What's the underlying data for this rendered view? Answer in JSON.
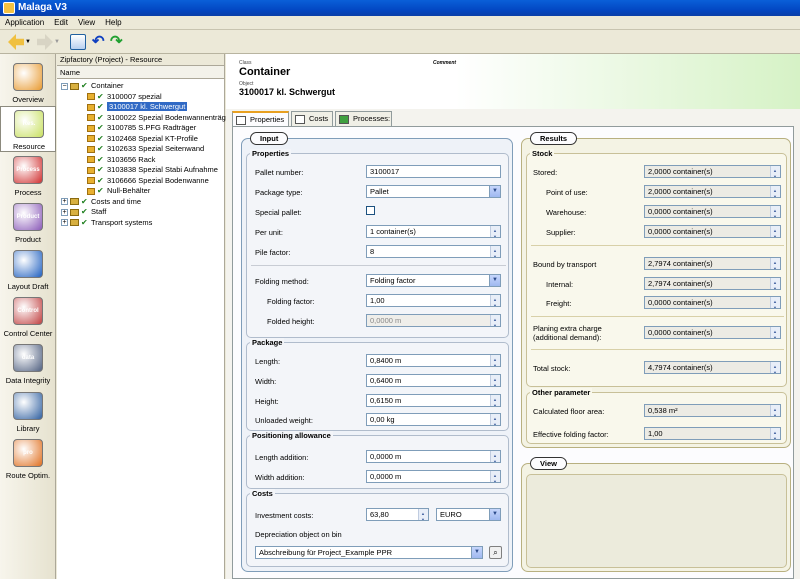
{
  "window": {
    "title": "Malaga V3"
  },
  "menu": [
    "Application",
    "Edit",
    "View",
    "Help"
  ],
  "nav": [
    {
      "label": "Overview",
      "icon": "overview-icon",
      "color": "#e89a30"
    },
    {
      "label": "Resource",
      "icon": "resource-icon",
      "color": "#c8e060",
      "selected": true,
      "text": "Res."
    },
    {
      "label": "Process",
      "icon": "process-icon",
      "color": "#d03030",
      "text": "Process"
    },
    {
      "label": "Product",
      "icon": "product-icon",
      "color": "#8a5ab8",
      "text": "Product"
    },
    {
      "label": "Layout Draft",
      "icon": "layout-draft-icon",
      "color": "#2060c0"
    },
    {
      "label": "Control Center",
      "icon": "control-center-icon",
      "color": "#c04040",
      "text": "Control Center"
    },
    {
      "label": "Data Integrity",
      "icon": "data-integrity-icon",
      "color": "#506080",
      "text": "data quality"
    },
    {
      "label": "Library",
      "icon": "library-icon",
      "color": "#3060a0"
    },
    {
      "label": "Route Optim.",
      "icon": "route-optim-icon",
      "color": "#e07020",
      "text": "pro"
    }
  ],
  "tree": {
    "title": "Zipfactory (Project) - Resource",
    "column": "Name",
    "nodes": [
      {
        "label": "Container",
        "level": 0,
        "type": "root"
      },
      {
        "label": "3100007 spezial",
        "level": 1,
        "type": "item"
      },
      {
        "label": "3100017 kl. Schwergut",
        "level": 1,
        "type": "item",
        "selected": true
      },
      {
        "label": "3100022 Spezial Bodenwannenträg",
        "level": 1,
        "type": "item"
      },
      {
        "label": "3100785 S.PFG Radträger",
        "level": 1,
        "type": "item"
      },
      {
        "label": "3102468 Spezial KT-Profile",
        "level": 1,
        "type": "item"
      },
      {
        "label": "3102633 Spezial Seitenwand",
        "level": 1,
        "type": "item"
      },
      {
        "label": "3103656 Rack",
        "level": 1,
        "type": "item"
      },
      {
        "label": "3103838 Spezial  Stabi Aufnahme",
        "level": 1,
        "type": "item"
      },
      {
        "label": "3106666 Spezial Bodenwanne",
        "level": 1,
        "type": "item"
      },
      {
        "label": "Null-Behälter",
        "level": 1,
        "type": "item"
      },
      {
        "label": "Costs and time",
        "level": 0,
        "type": "root"
      },
      {
        "label": "Staff",
        "level": 0,
        "type": "root"
      },
      {
        "label": "Transport systems",
        "level": 0,
        "type": "root"
      }
    ]
  },
  "header": {
    "class_label": "Class",
    "class_value": "Container",
    "object_label": "Object",
    "object_value": "3100017 kl. Schwergut",
    "comment_label": "Comment"
  },
  "tabs": [
    "Properties",
    "Costs",
    "Processes:"
  ],
  "input": {
    "title": "Input",
    "properties": {
      "title": "Properties",
      "pallet_number_label": "Pallet number:",
      "pallet_number": "3100017",
      "package_type_label": "Package type:",
      "package_type": "Pallet",
      "special_pallet_label": "Special pallet:",
      "per_unit_label": "Per unit:",
      "per_unit": "1 container(s)",
      "pile_factor_label": "Pile factor:",
      "pile_factor": "8",
      "folding_method_label": "Folding method:",
      "folding_method": "Folding factor",
      "folding_factor_label": "Folding factor:",
      "folding_factor": "1,00",
      "folded_height_label": "Folded height:",
      "folded_height": "0,0000 m"
    },
    "package": {
      "title": "Package",
      "length_label": "Length:",
      "length": "0,8400 m",
      "width_label": "Width:",
      "width": "0,6400 m",
      "height_label": "Height:",
      "height": "0,6150 m",
      "unloaded_label": "Unloaded weight:",
      "unloaded": "0,00 kg"
    },
    "positioning": {
      "title": "Positioning allowance",
      "length_label": "Length addition:",
      "length": "0,0000 m",
      "width_label": "Width addition:",
      "width": "0,0000 m"
    },
    "costs": {
      "title": "Costs",
      "investment_label": "Investment costs:",
      "investment": "63,80",
      "currency": "EURO",
      "depreciation_label": "Depreciation object on bin",
      "depreciation": "Abschreibung für Project_Example PPR"
    }
  },
  "results": {
    "title": "Results",
    "stock": {
      "title": "Stock",
      "stored_label": "Stored:",
      "stored": "2,0000 container(s)",
      "point_label": "Point of use:",
      "point": "2,0000 container(s)",
      "warehouse_label": "Warehouse:",
      "warehouse": "0,0000 container(s)",
      "supplier_label": "Supplier:",
      "supplier": "0,0000 container(s)",
      "bound_label": "Bound by transport",
      "bound": "2,7974 container(s)",
      "internal_label": "Internal:",
      "internal": "2,7974 container(s)",
      "freight_label": "Freight:",
      "freight": "0,0000 container(s)",
      "planing_label1": "Planing extra charge",
      "planing_label2": "(additional demand):",
      "planing": "0,0000 container(s)",
      "total_label": "Total stock:",
      "total": "4,7974 container(s)"
    },
    "other": {
      "title": "Other parameter",
      "floor_label": "Calculated floor area:",
      "floor": "0,538 m²",
      "eff_label": "Effective folding factor:",
      "eff": "1,00"
    }
  },
  "view": {
    "title": "View"
  }
}
